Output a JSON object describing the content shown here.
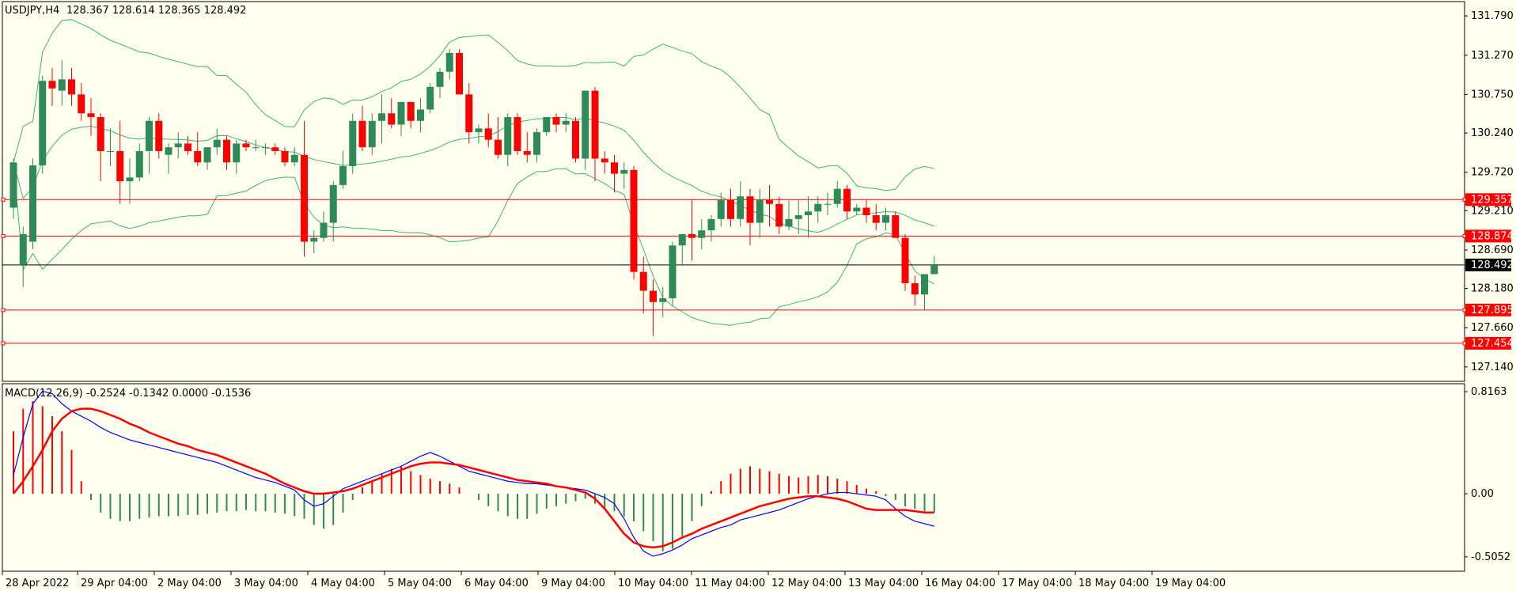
{
  "header": {
    "symbol_tf": "USDJPY,H4",
    "ohlc": "128.367 128.614 128.365 128.492"
  },
  "macd_header": "MACD(12,26,9) -0.2524 -0.1342 0.0000 -0.1536",
  "colors": {
    "background": "#fffff0",
    "bull": "#2e8b57",
    "bear": "#ff0000",
    "band": "#3cb371",
    "macd_line": "#0000ff",
    "signal_line": "#ff0000",
    "level_line": "#ff0000",
    "price_line": "#000000"
  },
  "chart_data": [
    {
      "type": "candlestick",
      "title": "USDJPY,H4",
      "y_ticks": [
        "131.790",
        "131.270",
        "130.750",
        "130.240",
        "129.720",
        "129.210",
        "128.690",
        "128.180",
        "127.660",
        "127.140"
      ],
      "ylim": [
        126.95,
        131.98
      ],
      "x_ticks": [
        "28 Apr 2022",
        "29 Apr 04:00",
        "2 May 04:00",
        "3 May 04:00",
        "4 May 04:00",
        "5 May 04:00",
        "6 May 04:00",
        "9 May 04:00",
        "10 May 04:00",
        "11 May 04:00",
        "12 May 04:00",
        "13 May 04:00",
        "16 May 04:00",
        "17 May 04:00",
        "18 May 04:00",
        "19 May 04:00"
      ],
      "levels": [
        {
          "value": 129.357,
          "label": "129.357"
        },
        {
          "value": 128.874,
          "label": "128.874"
        },
        {
          "value": 127.895,
          "label": "127.895"
        },
        {
          "value": 127.454,
          "label": "127.454"
        }
      ],
      "current_price": {
        "value": 128.492,
        "label": "128.492"
      },
      "candles": [
        [
          129.25,
          129.9,
          129.1,
          129.85
        ],
        [
          128.5,
          129.0,
          128.2,
          128.9
        ],
        [
          128.8,
          129.9,
          128.7,
          129.81
        ],
        [
          129.81,
          131.0,
          129.7,
          130.93
        ],
        [
          130.93,
          131.1,
          130.6,
          130.83
        ],
        [
          130.8,
          131.2,
          130.6,
          130.95
        ],
        [
          130.95,
          131.1,
          130.6,
          130.75
        ],
        [
          130.75,
          130.9,
          130.4,
          130.5
        ],
        [
          130.5,
          130.7,
          130.2,
          130.45
        ],
        [
          130.45,
          130.5,
          129.6,
          130.0
        ],
        [
          130.0,
          130.3,
          129.8,
          130.0
        ],
        [
          130.0,
          130.4,
          129.3,
          129.6
        ],
        [
          129.6,
          129.9,
          129.3,
          129.65
        ],
        [
          129.65,
          130.1,
          129.6,
          130.0
        ],
        [
          130.0,
          130.45,
          129.7,
          130.4
        ],
        [
          130.4,
          130.5,
          129.9,
          130.0
        ],
        [
          129.95,
          130.1,
          129.7,
          130.05
        ],
        [
          130.05,
          130.25,
          129.9,
          130.1
        ],
        [
          130.1,
          130.2,
          129.95,
          130.0
        ],
        [
          130.0,
          130.25,
          129.8,
          129.85
        ],
        [
          129.85,
          130.05,
          129.75,
          130.05
        ],
        [
          130.05,
          130.3,
          129.95,
          130.15
        ],
        [
          130.15,
          130.2,
          129.75,
          129.85
        ],
        [
          129.85,
          130.15,
          129.7,
          130.1
        ],
        [
          130.1,
          130.15,
          130.0,
          130.05
        ],
        [
          130.05,
          130.15,
          130.0,
          130.05
        ],
        [
          130.05,
          130.1,
          129.95,
          130.05
        ],
        [
          130.05,
          130.1,
          129.95,
          130.0
        ],
        [
          130.0,
          130.05,
          129.8,
          129.85
        ],
        [
          129.85,
          130.05,
          129.8,
          129.95
        ],
        [
          129.95,
          130.4,
          128.6,
          128.8
        ],
        [
          128.8,
          128.95,
          128.65,
          128.85
        ],
        [
          128.85,
          129.2,
          128.8,
          129.05
        ],
        [
          129.05,
          129.6,
          128.8,
          129.55
        ],
        [
          129.55,
          130.0,
          129.5,
          129.8
        ],
        [
          129.8,
          130.5,
          129.7,
          130.4
        ],
        [
          130.4,
          130.6,
          130.0,
          130.05
        ],
        [
          130.05,
          130.5,
          129.95,
          130.4
        ],
        [
          130.4,
          130.75,
          130.1,
          130.5
        ],
        [
          130.5,
          130.7,
          130.3,
          130.35
        ],
        [
          130.35,
          130.65,
          130.2,
          130.65
        ],
        [
          130.65,
          130.65,
          130.3,
          130.4
        ],
        [
          130.4,
          130.7,
          130.25,
          130.55
        ],
        [
          130.55,
          130.9,
          130.5,
          130.85
        ],
        [
          130.85,
          131.1,
          130.7,
          131.05
        ],
        [
          131.05,
          131.35,
          130.95,
          131.3
        ],
        [
          131.3,
          131.35,
          130.75,
          130.75
        ],
        [
          130.75,
          130.9,
          130.1,
          130.25
        ],
        [
          130.25,
          130.35,
          130.1,
          130.3
        ],
        [
          130.3,
          130.5,
          130.05,
          130.15
        ],
        [
          130.15,
          130.45,
          129.9,
          129.95
        ],
        [
          129.95,
          130.5,
          129.8,
          130.45
        ],
        [
          130.45,
          130.5,
          129.95,
          130.0
        ],
        [
          130.0,
          130.25,
          129.85,
          129.95
        ],
        [
          129.95,
          130.3,
          129.85,
          130.25
        ],
        [
          130.25,
          130.45,
          130.2,
          130.45
        ],
        [
          130.45,
          130.5,
          130.25,
          130.35
        ],
        [
          130.35,
          130.5,
          130.25,
          130.4
        ],
        [
          130.4,
          130.45,
          129.85,
          129.9
        ],
        [
          129.9,
          130.8,
          129.75,
          130.8
        ],
        [
          130.8,
          130.85,
          129.6,
          129.9
        ],
        [
          129.9,
          130.0,
          129.7,
          129.85
        ],
        [
          129.85,
          129.95,
          129.45,
          129.7
        ],
        [
          129.7,
          129.85,
          129.5,
          129.75
        ],
        [
          129.75,
          129.8,
          128.3,
          128.4
        ],
        [
          128.4,
          128.6,
          127.85,
          128.15
        ],
        [
          128.15,
          128.3,
          127.55,
          128.0
        ],
        [
          128.0,
          128.2,
          127.8,
          128.05
        ],
        [
          128.05,
          128.8,
          127.95,
          128.75
        ],
        [
          128.75,
          128.9,
          128.5,
          128.9
        ],
        [
          128.9,
          129.35,
          128.55,
          128.85
        ],
        [
          128.85,
          129.1,
          128.7,
          128.95
        ],
        [
          128.95,
          129.15,
          128.8,
          129.1
        ],
        [
          129.1,
          129.45,
          129.0,
          129.35
        ],
        [
          129.35,
          129.5,
          129.0,
          129.1
        ],
        [
          129.1,
          129.6,
          129.0,
          129.4
        ],
        [
          129.4,
          129.5,
          128.75,
          129.05
        ],
        [
          129.05,
          129.5,
          128.85,
          129.35
        ],
        [
          129.35,
          129.55,
          129.0,
          129.3
        ],
        [
          129.3,
          129.4,
          128.9,
          129.0
        ],
        [
          129.0,
          129.35,
          128.95,
          129.1
        ],
        [
          129.1,
          129.35,
          128.9,
          129.15
        ],
        [
          129.15,
          129.4,
          128.85,
          129.2
        ],
        [
          129.2,
          129.4,
          129.05,
          129.3
        ],
        [
          129.3,
          129.45,
          129.15,
          129.3
        ],
        [
          129.3,
          129.6,
          129.25,
          129.5
        ],
        [
          129.5,
          129.55,
          129.1,
          129.2
        ],
        [
          129.2,
          129.3,
          129.15,
          129.25
        ],
        [
          129.25,
          129.35,
          129.05,
          129.15
        ],
        [
          129.15,
          129.3,
          128.95,
          129.05
        ],
        [
          129.05,
          129.25,
          128.95,
          129.15
        ],
        [
          129.15,
          129.2,
          128.85,
          128.85
        ],
        [
          128.85,
          128.9,
          128.15,
          128.25
        ],
        [
          128.25,
          128.35,
          127.95,
          128.1
        ],
        [
          128.1,
          128.3,
          127.9,
          128.37
        ],
        [
          128.37,
          128.61,
          128.37,
          128.49
        ]
      ]
    },
    {
      "type": "macd",
      "title": "MACD(12,26,9) -0.2524 -0.1342 0.0000 -0.1536",
      "y_ticks": [
        "0.8163",
        "0.00",
        "-0.5052"
      ],
      "ylim": [
        -0.62,
        0.88
      ],
      "histogram": [
        0.5,
        0.68,
        0.74,
        0.7,
        0.62,
        0.5,
        0.35,
        0.1,
        -0.05,
        -0.15,
        -0.2,
        -0.22,
        -0.22,
        -0.2,
        -0.19,
        -0.18,
        -0.18,
        -0.18,
        -0.17,
        -0.17,
        -0.16,
        -0.15,
        -0.14,
        -0.14,
        -0.13,
        -0.14,
        -0.14,
        -0.15,
        -0.16,
        -0.18,
        -0.2,
        -0.25,
        -0.28,
        -0.25,
        -0.15,
        -0.05,
        0.05,
        0.1,
        0.16,
        0.2,
        0.22,
        0.18,
        0.15,
        0.12,
        0.1,
        0.08,
        0.05,
        0.0,
        -0.05,
        -0.1,
        -0.14,
        -0.18,
        -0.2,
        -0.2,
        -0.16,
        -0.12,
        -0.1,
        -0.08,
        -0.06,
        -0.04,
        -0.08,
        -0.12,
        -0.14,
        -0.18,
        -0.22,
        -0.3,
        -0.38,
        -0.46,
        -0.44,
        -0.34,
        -0.22,
        -0.1,
        0.02,
        0.1,
        0.16,
        0.2,
        0.22,
        0.2,
        0.18,
        0.16,
        0.14,
        0.13,
        0.14,
        0.15,
        0.14,
        0.12,
        0.1,
        0.07,
        0.04,
        0.02,
        -0.02,
        -0.05,
        -0.1,
        -0.12,
        -0.14,
        -0.15
      ],
      "macd": [
        0.15,
        0.45,
        0.72,
        0.82,
        0.8,
        0.72,
        0.66,
        0.62,
        0.58,
        0.53,
        0.49,
        0.46,
        0.43,
        0.41,
        0.39,
        0.37,
        0.35,
        0.33,
        0.31,
        0.29,
        0.27,
        0.25,
        0.22,
        0.19,
        0.16,
        0.13,
        0.11,
        0.09,
        0.06,
        0.03,
        -0.05,
        -0.1,
        -0.08,
        -0.02,
        0.04,
        0.07,
        0.1,
        0.13,
        0.16,
        0.19,
        0.22,
        0.26,
        0.3,
        0.33,
        0.3,
        0.26,
        0.22,
        0.18,
        0.16,
        0.14,
        0.12,
        0.1,
        0.09,
        0.08,
        0.08,
        0.07,
        0.06,
        0.05,
        0.04,
        0.03,
        0.0,
        -0.03,
        -0.08,
        -0.2,
        -0.35,
        -0.46,
        -0.5,
        -0.48,
        -0.45,
        -0.41,
        -0.36,
        -0.33,
        -0.3,
        -0.27,
        -0.25,
        -0.21,
        -0.19,
        -0.17,
        -0.15,
        -0.13,
        -0.1,
        -0.07,
        -0.04,
        -0.02,
        0.0,
        0.01,
        0.01,
        0.0,
        -0.01,
        -0.02,
        -0.05,
        -0.12,
        -0.18,
        -0.22,
        -0.24,
        -0.26
      ],
      "signal": [
        0.0,
        0.1,
        0.22,
        0.35,
        0.5,
        0.6,
        0.66,
        0.68,
        0.68,
        0.66,
        0.63,
        0.6,
        0.56,
        0.53,
        0.49,
        0.46,
        0.43,
        0.4,
        0.38,
        0.35,
        0.33,
        0.31,
        0.28,
        0.25,
        0.22,
        0.19,
        0.16,
        0.12,
        0.08,
        0.05,
        0.02,
        0.0,
        0.0,
        0.01,
        0.02,
        0.04,
        0.07,
        0.1,
        0.13,
        0.16,
        0.19,
        0.22,
        0.24,
        0.25,
        0.25,
        0.24,
        0.23,
        0.21,
        0.19,
        0.17,
        0.15,
        0.13,
        0.11,
        0.1,
        0.09,
        0.08,
        0.06,
        0.05,
        0.03,
        0.01,
        -0.04,
        -0.12,
        -0.22,
        -0.32,
        -0.39,
        -0.42,
        -0.43,
        -0.42,
        -0.39,
        -0.35,
        -0.32,
        -0.28,
        -0.25,
        -0.22,
        -0.19,
        -0.16,
        -0.13,
        -0.1,
        -0.08,
        -0.06,
        -0.04,
        -0.03,
        -0.02,
        -0.02,
        -0.03,
        -0.04,
        -0.06,
        -0.09,
        -0.12,
        -0.13,
        -0.13,
        -0.13,
        -0.13,
        -0.14,
        -0.15,
        -0.15
      ]
    }
  ]
}
